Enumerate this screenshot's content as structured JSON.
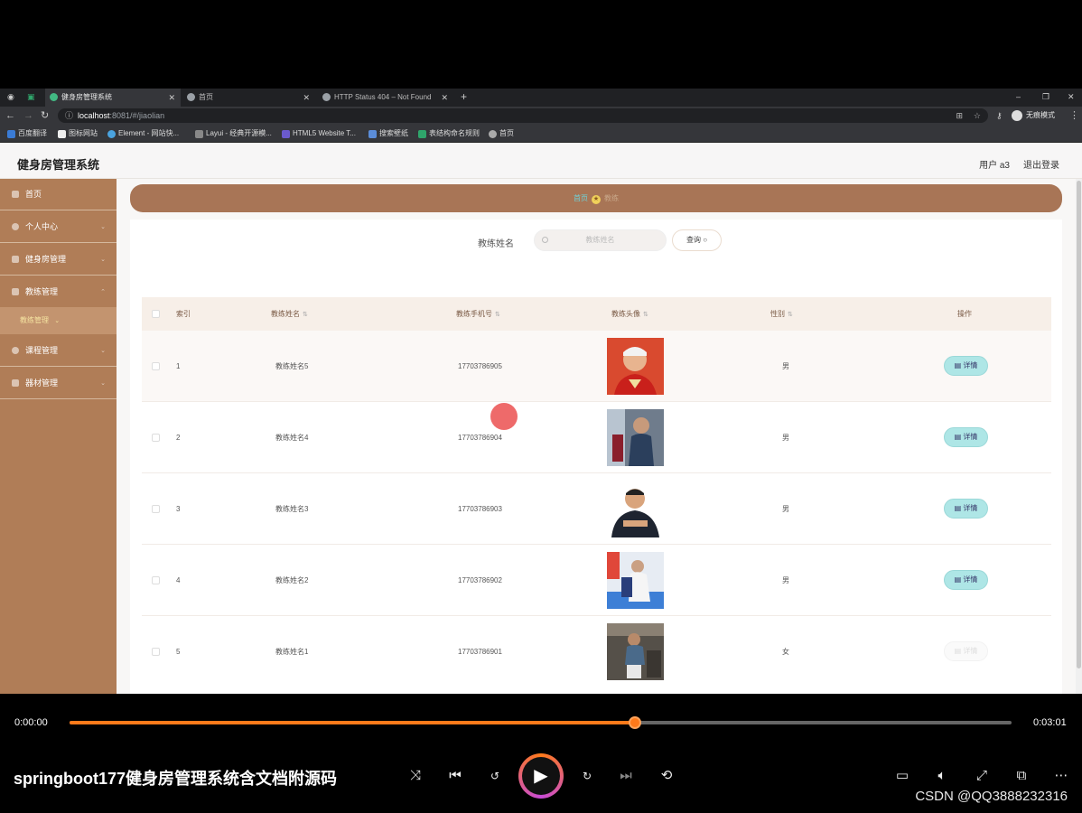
{
  "browser": {
    "tabs": [
      {
        "title": "健身房管理系统"
      },
      {
        "title": "首页"
      },
      {
        "title": "HTTP Status 404 – Not Found"
      }
    ],
    "new_tab": "+",
    "url_host": "localhost",
    "url_path": ":8081/#/jiaolian",
    "profile_label": "无痕模式",
    "window_controls": [
      "–",
      "❐",
      "✕"
    ],
    "bookmarks": [
      "百度翻译",
      "图标网站",
      "Element - 网站快...",
      "Layui - 经典开源模...",
      "HTML5 Website T...",
      "搜索壁纸",
      "表结构命名规则",
      "首页"
    ]
  },
  "app": {
    "title": "健身房管理系统",
    "user": "用户 a3",
    "logout": "退出登录"
  },
  "sidebar": {
    "items": [
      {
        "label": "首页",
        "icon": "home-icon"
      },
      {
        "label": "个人中心",
        "icon": "user-icon"
      },
      {
        "label": "健身房管理",
        "icon": "grid-icon"
      },
      {
        "label": "教练管理",
        "icon": "grid-icon"
      },
      {
        "label": "课程管理",
        "icon": "gear-icon"
      },
      {
        "label": "器材管理",
        "icon": "grid-icon"
      }
    ],
    "subitem": "教练管理"
  },
  "breadcrumb": {
    "home": "首页",
    "current": "教练"
  },
  "search": {
    "label": "教练姓名",
    "placeholder": "教练姓名",
    "button": "查询"
  },
  "table": {
    "headers": [
      "索引",
      "教练姓名",
      "教练手机号",
      "教练头像",
      "性别",
      "操作"
    ],
    "rows": [
      {
        "index": "1",
        "name": "教练姓名5",
        "phone": "17703786905",
        "gender": "男",
        "action": "详情"
      },
      {
        "index": "2",
        "name": "教练姓名4",
        "phone": "17703786904",
        "gender": "男",
        "action": "详情"
      },
      {
        "index": "3",
        "name": "教练姓名3",
        "phone": "17703786903",
        "gender": "男",
        "action": "详情"
      },
      {
        "index": "4",
        "name": "教练姓名2",
        "phone": "17703786902",
        "gender": "男",
        "action": "详情"
      },
      {
        "index": "5",
        "name": "教练姓名1",
        "phone": "17703786901",
        "gender": "女",
        "action": "详情"
      }
    ]
  },
  "player": {
    "current_time": "0:00:00",
    "total_time": "0:03:01",
    "progress": 0.6,
    "title": "springboot177健身房管理系统含文档附源码",
    "watermark": "CSDN @QQ3888232316",
    "accent": "#ff7a1a"
  }
}
